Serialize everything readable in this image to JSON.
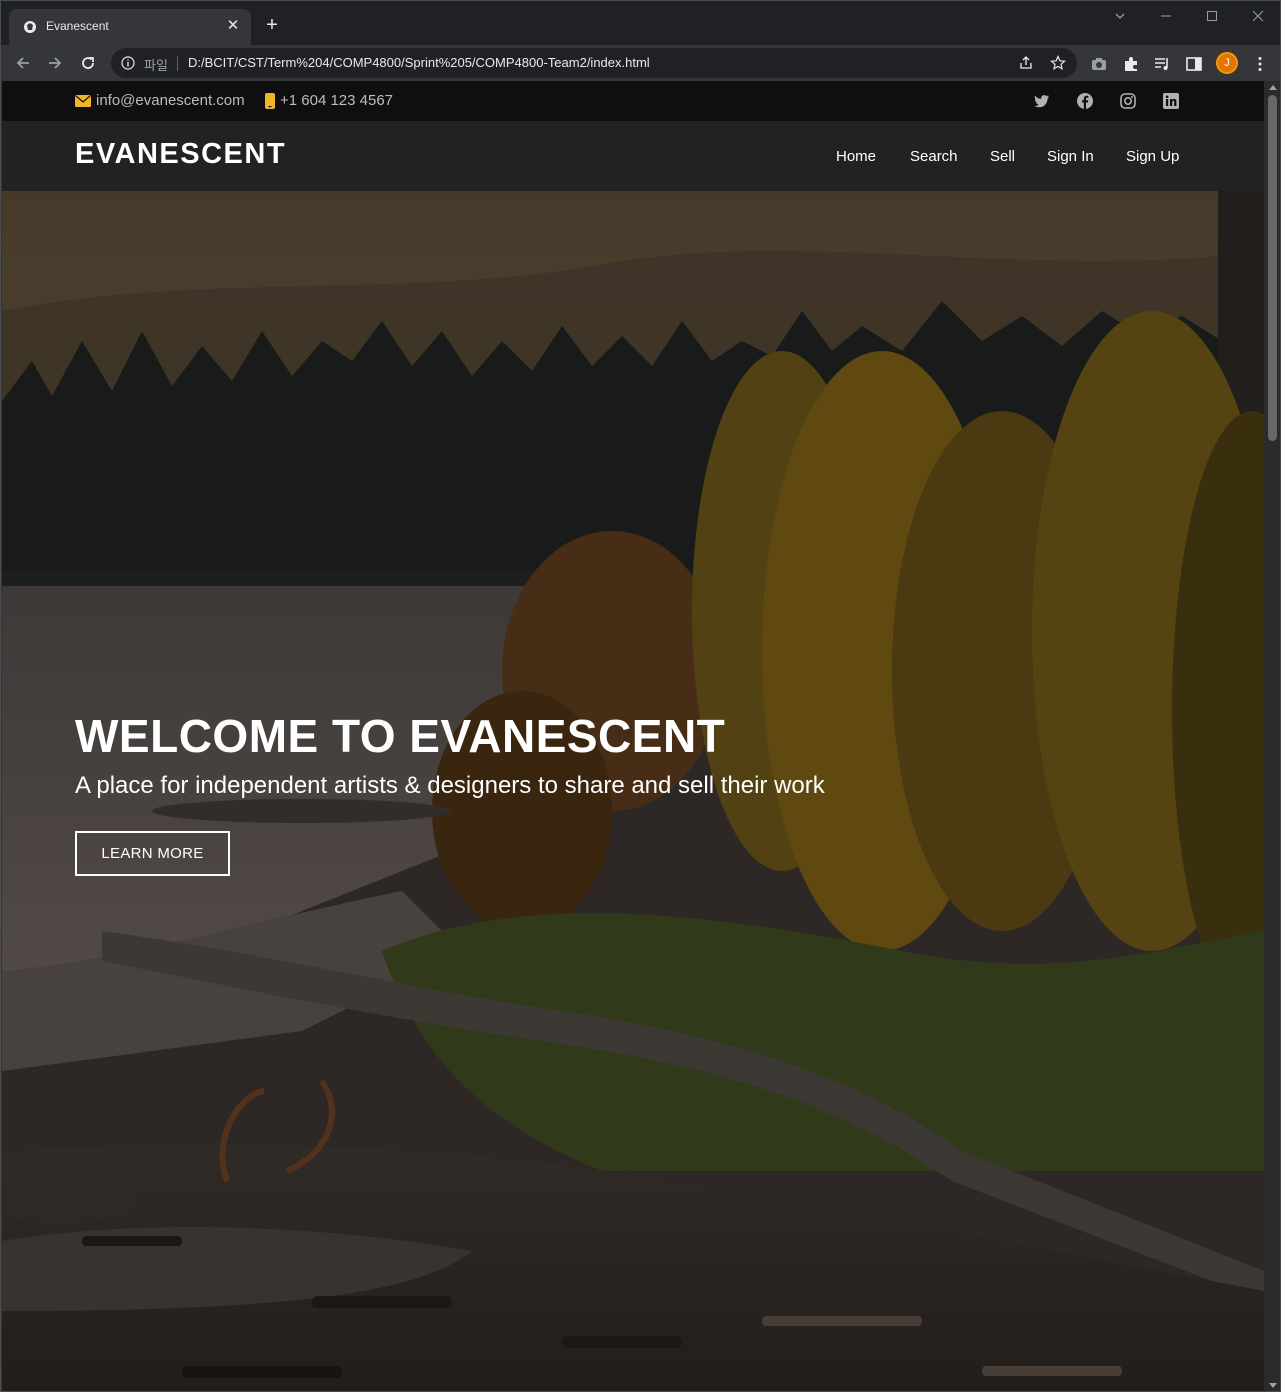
{
  "browser": {
    "tab_title": "Evanescent",
    "scheme_label": "파일",
    "url": "D:/BCIT/CST/Term%204/COMP4800/Sprint%205/COMP4800-Team2/index.html",
    "profile_initial": "J"
  },
  "topbar": {
    "email": "info@evanescent.com",
    "phone": "+1 604 123 4567",
    "social_icons": [
      "twitter-icon",
      "facebook-icon",
      "instagram-icon",
      "linkedin-icon"
    ]
  },
  "header": {
    "logo": "EVANESCENT",
    "nav": [
      "Home",
      "Search",
      "Sell",
      "Sign In",
      "Sign Up"
    ]
  },
  "hero": {
    "title": "WELCOME TO EVANESCENT",
    "subtitle": "A place for independent artists & designers to share and sell their work",
    "button": "LEARN MORE"
  },
  "colors": {
    "topbar_bg": "#0f0f0f",
    "header_bg": "#222222",
    "email_icon": "#f0b429",
    "phone_icon": "#f0b429",
    "browser_chrome": "#35363a"
  }
}
